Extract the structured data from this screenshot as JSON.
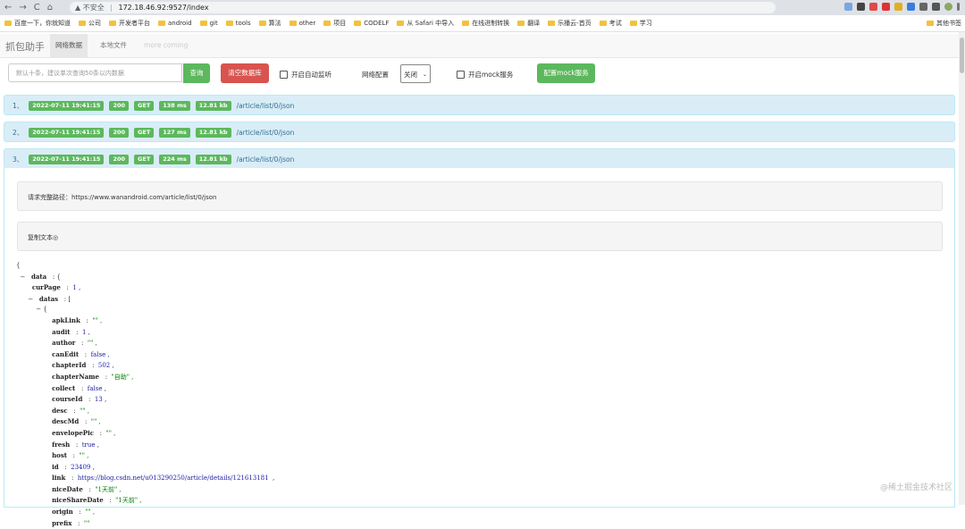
{
  "browser": {
    "security_label": "不安全",
    "url": "172.18.46.92:9527/index",
    "bookmarks": [
      "百度一下，你就知道",
      "公司",
      "开发者平台",
      "android",
      "git",
      "tools",
      "算法",
      "other",
      "项目",
      "CODELF",
      "从 Safari 中导入",
      "在线进制转换",
      "翻译",
      "乐播云-首页",
      "考试",
      "学习"
    ],
    "other_bookmarks": "其他书签"
  },
  "app": {
    "brand": "抓包助手",
    "tabs": [
      {
        "label": "网络数据",
        "state": "active"
      },
      {
        "label": "本地文件",
        "state": "normal"
      },
      {
        "label": "more coming",
        "state": "disabled"
      }
    ]
  },
  "toolbar": {
    "search_placeholder": "默认十条，建议单次查询50条以内数据",
    "query_label": "查询",
    "clear_label": "清空数据库",
    "auto_listen_label": "开启自动监听",
    "network_config_label": "网络配置",
    "network_select_value": "关闭",
    "mock_service_label": "开启mock服务",
    "config_mock_label": "配置mock服务"
  },
  "requests": [
    {
      "num": "1、",
      "time": "2022-07-11 19:41:15",
      "status": "200",
      "method": "GET",
      "duration": "138 ms",
      "size": "12.81 kb",
      "path": "/article/list/0/json"
    },
    {
      "num": "2、",
      "time": "2022-07-11 19:41:15",
      "status": "200",
      "method": "GET",
      "duration": "127 ms",
      "size": "12.81 kb",
      "path": "/article/list/0/json"
    },
    {
      "num": "3、",
      "time": "2022-07-11 19:41:15",
      "status": "200",
      "method": "GET",
      "duration": "224 ms",
      "size": "12.81 kb",
      "path": "/article/list/0/json"
    }
  ],
  "detail": {
    "full_path": "请求完整路径：https://www.wanandroid.com/article/list/0/json",
    "copy_label": "复制文本◎"
  },
  "json_lines": [
    {
      "indent": 0,
      "prefix": "{",
      "key": "",
      "value": "",
      "vtype": ""
    },
    {
      "indent": 1,
      "prefix": "−   ",
      "key": "data",
      "value": ": {",
      "vtype": "p"
    },
    {
      "indent": 4,
      "prefix": "",
      "key": "curPage",
      "value": "1 ,",
      "vtype": "n"
    },
    {
      "indent": 3,
      "prefix": "−   ",
      "key": "datas",
      "value": ": [",
      "vtype": "p"
    },
    {
      "indent": 5,
      "prefix": "− {",
      "key": "",
      "value": "",
      "vtype": ""
    },
    {
      "indent": 9,
      "prefix": "",
      "key": "apkLink",
      "value": "\"\" ,",
      "vtype": "s"
    },
    {
      "indent": 9,
      "prefix": "",
      "key": "audit",
      "value": "1 ,",
      "vtype": "n"
    },
    {
      "indent": 9,
      "prefix": "",
      "key": "author",
      "value": "\"\" ,",
      "vtype": "s"
    },
    {
      "indent": 9,
      "prefix": "",
      "key": "canEdit",
      "value": "false ,",
      "vtype": "b"
    },
    {
      "indent": 9,
      "prefix": "",
      "key": "chapterId",
      "value": "502 ,",
      "vtype": "n"
    },
    {
      "indent": 9,
      "prefix": "",
      "key": "chapterName",
      "value": "\"自助\" ,",
      "vtype": "s"
    },
    {
      "indent": 9,
      "prefix": "",
      "key": "collect",
      "value": "false ,",
      "vtype": "b"
    },
    {
      "indent": 9,
      "prefix": "",
      "key": "courseId",
      "value": "13 ,",
      "vtype": "n"
    },
    {
      "indent": 9,
      "prefix": "",
      "key": "desc",
      "value": "\"\" ,",
      "vtype": "s"
    },
    {
      "indent": 9,
      "prefix": "",
      "key": "descMd",
      "value": "\"\" ,",
      "vtype": "s"
    },
    {
      "indent": 9,
      "prefix": "",
      "key": "envelopePic",
      "value": "\"\" ,",
      "vtype": "s"
    },
    {
      "indent": 9,
      "prefix": "",
      "key": "fresh",
      "value": "true ,",
      "vtype": "b"
    },
    {
      "indent": 9,
      "prefix": "",
      "key": "host",
      "value": "\"\" ,",
      "vtype": "s"
    },
    {
      "indent": 9,
      "prefix": "",
      "key": "id",
      "value": "23409 ,",
      "vtype": "n"
    },
    {
      "indent": 9,
      "prefix": "",
      "key": "link",
      "value": "https://blog.csdn.net/u013290250/article/details/121613181  ,",
      "vtype": "n"
    },
    {
      "indent": 9,
      "prefix": "",
      "key": "niceDate",
      "value": "\"1天前\" ,",
      "vtype": "s"
    },
    {
      "indent": 9,
      "prefix": "",
      "key": "niceShareDate",
      "value": "\"1天前\" ,",
      "vtype": "s"
    },
    {
      "indent": 9,
      "prefix": "",
      "key": "origin",
      "value": "\"\" ,",
      "vtype": "s"
    },
    {
      "indent": 9,
      "prefix": "",
      "key": "prefix",
      "value": "\"\"",
      "vtype": "s"
    }
  ],
  "watermark": "@稀土掘金技术社区",
  "colors": {
    "badge": "#5cb85c",
    "row_bg": "#d9edf7",
    "danger": "#d9534f"
  }
}
